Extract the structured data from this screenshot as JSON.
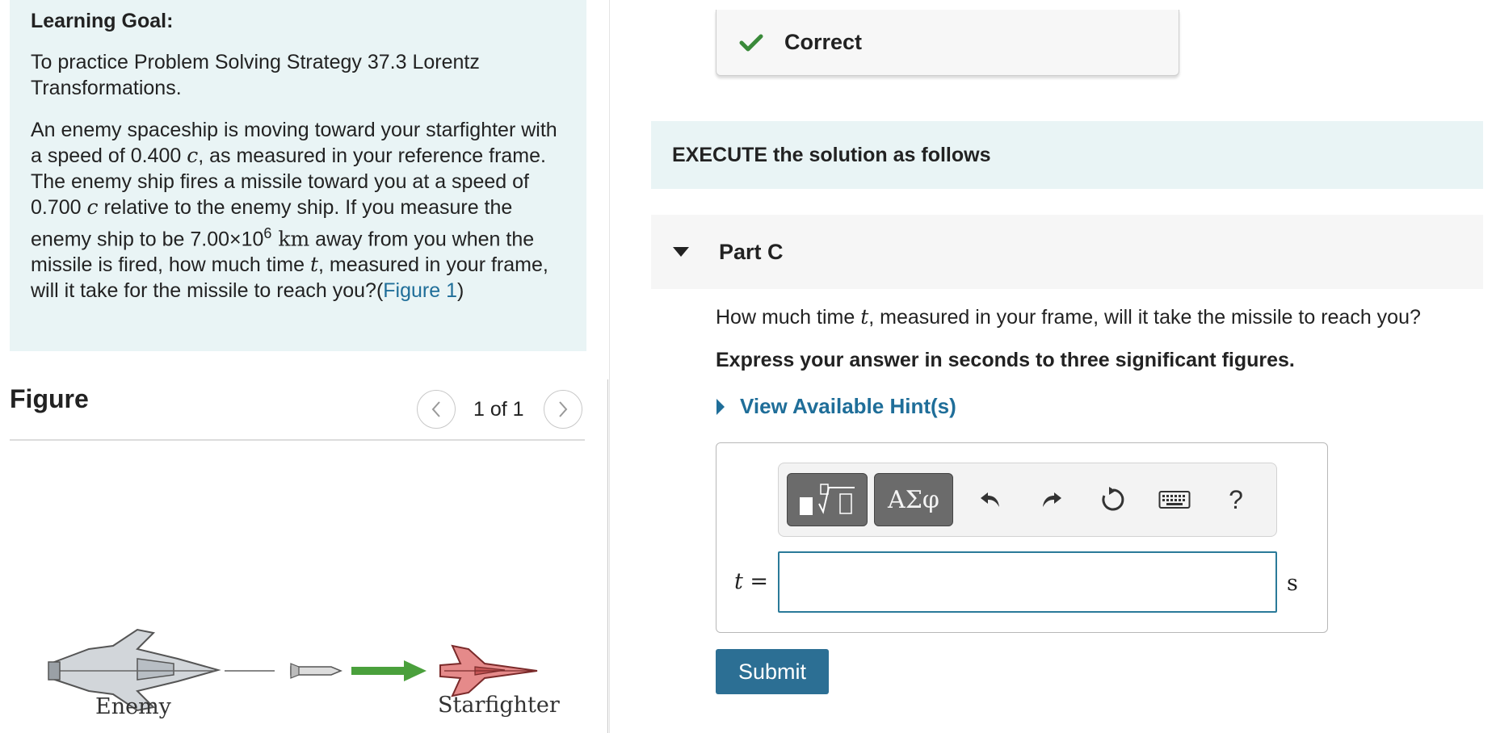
{
  "left_panel": {
    "goal_title": "Learning Goal:",
    "goal_intro": "To practice Problem Solving Strategy 37.3 Lorentz Transformations.",
    "problem": {
      "p1": "An enemy spaceship is moving toward your starfighter with a speed of 0.400 ",
      "c1": "c",
      "p2": ", as measured in your reference frame. The enemy ship fires a missile toward you at a speed of 0.700 ",
      "c2": "c",
      "p3": " relative to the enemy ship. If you measure the enemy ship to be 7.00×10",
      "exp": "6",
      "km": " km",
      "p4": " away from you when the missile is fired, how much time ",
      "t": "t",
      "p5": ", measured in your frame, will it take for the missile to reach you?(",
      "figure_link": "Figure 1",
      "p6": ")"
    },
    "figure": {
      "title": "Figure",
      "counter": "1 of 1",
      "enemy_label": "Enemy",
      "starfighter_label": "Starfighter"
    }
  },
  "feedback": {
    "label": "Correct",
    "color": "#3a8a3a"
  },
  "section": {
    "title": "EXECUTE the solution as follows"
  },
  "part": {
    "label": "Part C"
  },
  "question": {
    "q1": "How much time ",
    "t": "t",
    "q2": ", measured in your frame, will it take the missile to reach you?",
    "instruction": "Express your answer in seconds to three significant figures.",
    "hints_label": "View Available Hint(s)"
  },
  "answer": {
    "toolbar": {
      "templates_icon": "fraction-sqrt-templates-icon",
      "greek_label": "ΑΣφ",
      "undo_icon": "undo-icon",
      "redo_icon": "redo-icon",
      "reset_icon": "reset-icon",
      "keyboard_icon": "keyboard-icon",
      "help_label": "?"
    },
    "var_label": "t =",
    "value": "",
    "unit": "s"
  },
  "submit_label": "Submit",
  "colors": {
    "accent": "#2c6f94",
    "panel_bg": "#e9f4f5",
    "link": "#1f6e99",
    "arrow_green": "#4aa03c",
    "starfighter_red": "#e07070"
  }
}
